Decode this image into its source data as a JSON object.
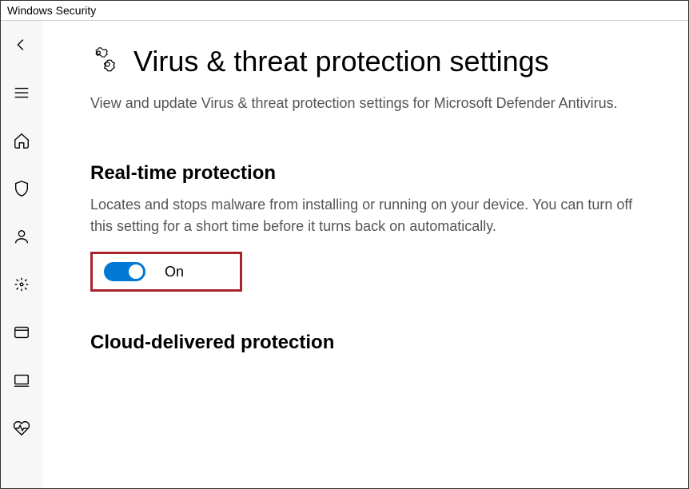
{
  "window": {
    "title": "Windows Security"
  },
  "sidebar": {
    "icons": [
      "back-icon",
      "menu-icon",
      "home-icon",
      "shield-icon",
      "account-icon",
      "firewall-icon",
      "app-browser-icon",
      "device-security-icon",
      "device-health-icon"
    ]
  },
  "header": {
    "icon": "settings-gears-icon",
    "title": "Virus & threat protection settings",
    "subtitle": "View and update Virus & threat protection settings for Microsoft Defender Antivirus."
  },
  "sections": {
    "realtime": {
      "title": "Real-time protection",
      "description": "Locates and stops malware from installing or running on your device. You can turn off this setting for a short time before it turns back on automatically.",
      "toggle_state": true,
      "toggle_label": "On"
    },
    "cloud": {
      "title": "Cloud-delivered protection"
    }
  }
}
